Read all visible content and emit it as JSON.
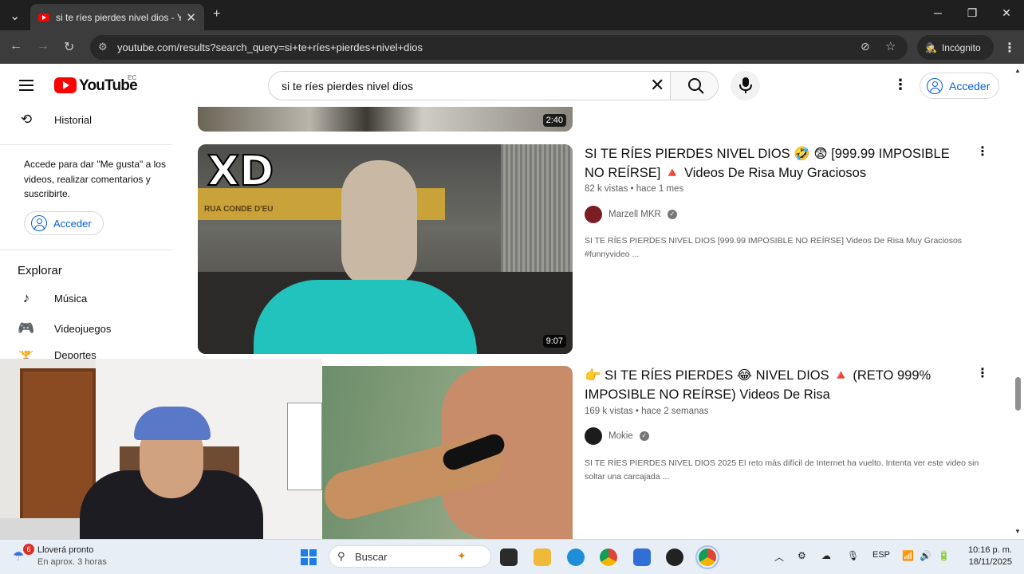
{
  "browser": {
    "tab_title": "si te ríes pierdes nivel dios - You",
    "new_tab": "+",
    "url": "youtube.com/results?search_query=si+te+ríes+pierdes+nivel+dios",
    "incognito_label": "Incógnito"
  },
  "youtube": {
    "logo_text": "YouTube",
    "country_code": "EC",
    "search_query": "si te ríes pierdes nivel dios",
    "signin_label": "Acceder"
  },
  "sidebar": {
    "history_label": "Historial",
    "signin_prompt": "Accede para dar \"Me gusta\" a los videos, realizar comentarios y suscribirte.",
    "signin_button": "Acceder",
    "explore_heading": "Explorar",
    "explore_items": [
      {
        "label": "Música",
        "icon": "music-note-icon"
      },
      {
        "label": "Videojuegos",
        "icon": "gamepad-icon"
      },
      {
        "label": "Deportes",
        "icon": "trophy-icon"
      }
    ]
  },
  "results": [
    {
      "duration": "2:40"
    },
    {
      "title": "SI TE RÍES PIERDES NIVEL DIOS 🤣 😨 [999.99 IMPOSIBLE NO REÍRSE] 🔺 Videos De Risa Muy Graciosos",
      "views": "82 k vistas",
      "age": "hace 1 mes",
      "meta_sep": " • ",
      "channel": "Marzell MKR",
      "description": "SI TE RÍES PIERDES NIVEL DIOS [999.99 IMPOSIBLE NO REÍRSE] Videos De Risa Muy Graciosos #funnyvideo ...",
      "duration": "9:07",
      "thumb_caption": "XD",
      "thumb_sign": "RUA CONDE D'EU"
    },
    {
      "title": "👉 SI TE RÍES PIERDES 😂 NIVEL DIOS 🔺 (RETO 999% IMPOSIBLE NO REÍRSE) Videos De Risa",
      "views": "169 k vistas",
      "age": "hace 2 semanas",
      "meta_sep": " • ",
      "channel": "Mokie",
      "description": "SI TE RÍES PIERDES NIVEL DIOS 2025 El reto más difícil de Internet ha vuelto. Intenta ver este video sin soltar una carcajada ..."
    }
  ],
  "taskbar": {
    "weather_badge": "6",
    "weather_title": "Lloverá pronto",
    "weather_sub": "En aprox. 3 horas",
    "search_placeholder": "Buscar",
    "language": "ESP",
    "time": "10:16 p. m.",
    "date": "18/11/2025"
  },
  "colors": {
    "youtube_red": "#ff0000",
    "link_blue": "#065fd4",
    "chrome_dark": "#1f1f1f"
  }
}
